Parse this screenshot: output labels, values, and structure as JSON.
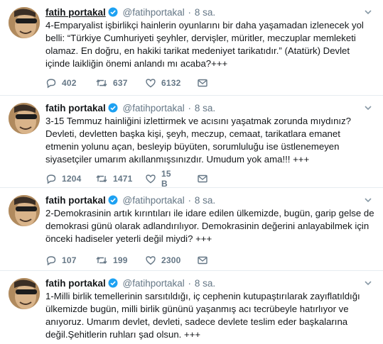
{
  "tweets": [
    {
      "name": "fatih portakal",
      "handle": "@fatihportakal",
      "separator": "·",
      "time": "8 sa.",
      "text": "4-Emparyalist işbirlikçi hainlerin oyunlarını bir daha yaşamadan izlenecek yol belli: “Türkiye Cumhuriyeti şeyhler, dervişler, müritler, meczuplar memleketi olamaz. En doğru, en hakiki tarikat medeniyet tarikatıdır.” (Atatürk) Devlet içinde laikliğin önemi anlandı mı acaba?+++",
      "replies": "402",
      "retweets": "637",
      "likes": "6132"
    },
    {
      "name": "fatih portakal",
      "handle": "@fatihportakal",
      "separator": "·",
      "time": "8 sa.",
      "text": "3-15 Temmuz hainliğini izlettirmek ve acısını yaşatmak zorunda mıydınız? Devleti, devletten başka kişi, şeyh, meczup, cemaat, tarikatlara emanet etmenin yolunu açan, besleyip büyüten, sorumluluğu ise üstlenemeyen siyasetçiler umarım akıllanmışsınızdır. Umudum yok ama!!! +++",
      "replies": "1204",
      "retweets": "1471",
      "likes": "15 B"
    },
    {
      "name": "fatih portakal",
      "handle": "@fatihportakal",
      "separator": "·",
      "time": "8 sa.",
      "text": "2-Demokrasinin artık kırıntıları ile idare edilen ülkemizde, bugün, garip gelse de demokrasi günü olarak adlandırılıyor. Demokrasinin değerini anlayabilmek için önceki hadiseler yeterli değil miydi? +++",
      "replies": "107",
      "retweets": "199",
      "likes": "2300"
    },
    {
      "name": "fatih portakal",
      "handle": "@fatihportakal",
      "separator": "·",
      "time": "8 sa.",
      "text": "1-Milli birlik temellerinin sarsıtıldığı, iç cephenin kutupaştırılarak zayıflatıldığı ülkemizde bugün, milli birlik gününü yaşanmış acı tecrübeyle hatırlıyor ve anıyoruz. Umarım devlet, devleti, sadece devlete teslim eder başkalarına değil.Şehitlerin ruhları şad olsun. +++"
    }
  ]
}
